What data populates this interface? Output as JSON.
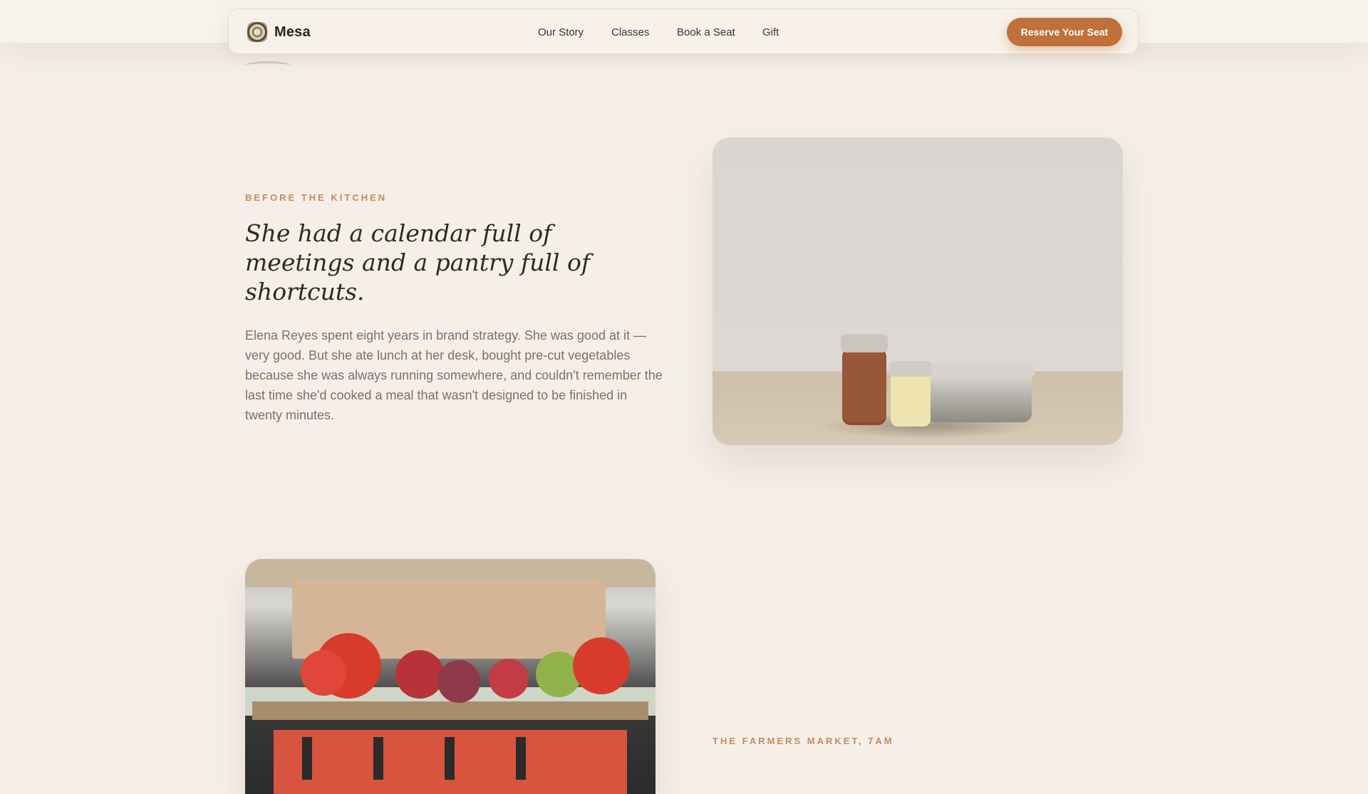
{
  "brand": {
    "name": "Mesa",
    "logo_icon": "mesa-logo-icon"
  },
  "nav": {
    "links": [
      "Our Story",
      "Classes",
      "Book a Seat",
      "Gift"
    ],
    "cta_label": "Reserve Your Seat"
  },
  "section1": {
    "eyebrow": "BEFORE THE KITCHEN",
    "headline": "She had a calendar full of meetings and a pantry full of shortcuts.",
    "body": "Elena Reyes spent eight years in brand strategy. She was good at it — very good. But she ate lunch at her desk, bought pre-cut vegetables because she was always running somewhere, and couldn't remember the last time she'd cooked a meal that wasn't designed to be finished in twenty minutes."
  },
  "section2": {
    "eyebrow": "THE FARMERS MARKET, 7AM"
  },
  "colors": {
    "background": "#f5efe8",
    "accent": "#c0703a",
    "eyebrow": "#c8895a",
    "headline": "#2e2a26",
    "body": "#7a716a"
  }
}
